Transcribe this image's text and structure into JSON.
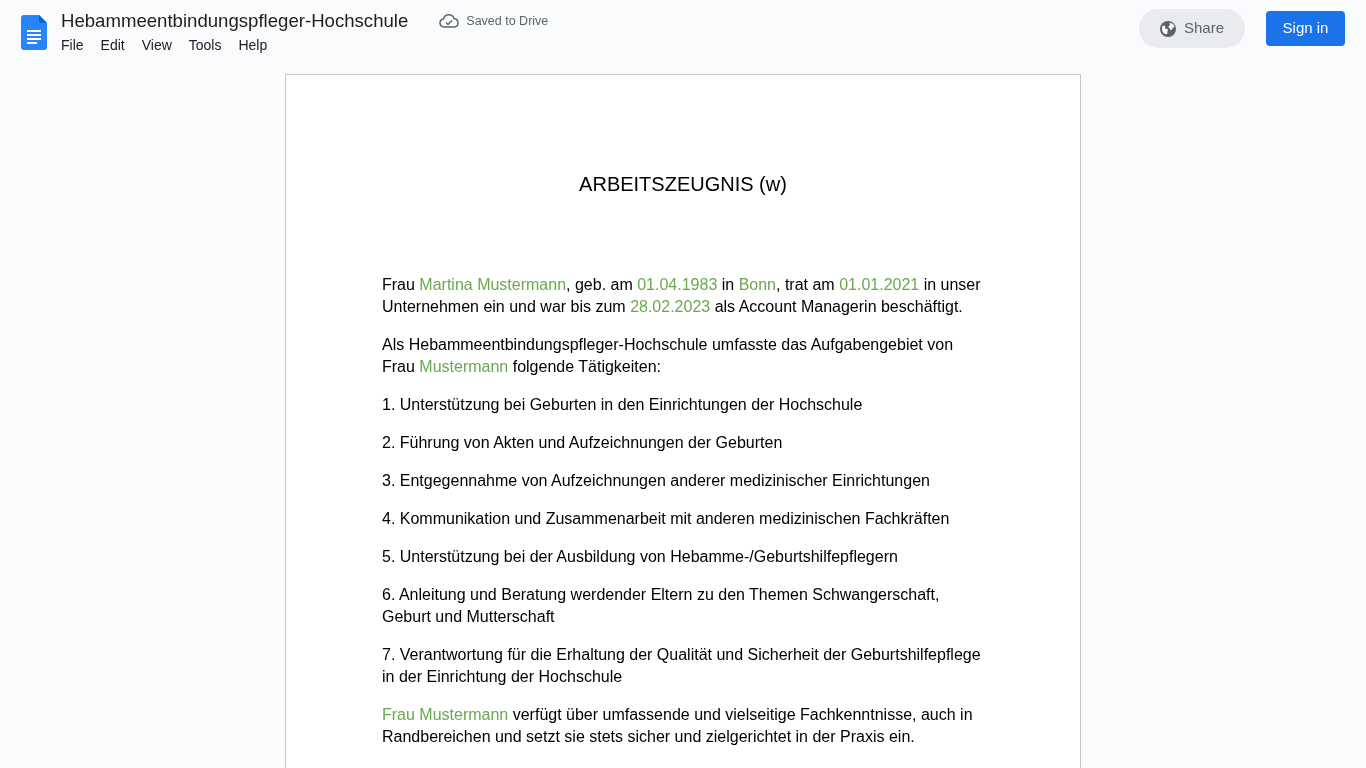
{
  "header": {
    "title": "Hebammeentbindungspfleger-Hochschule",
    "menu": [
      "File",
      "Edit",
      "View",
      "Tools",
      "Help"
    ],
    "save_status": "Saved to Drive",
    "share_button": "Share",
    "sign_in_button": "Sign in"
  },
  "document": {
    "title": "ARBEITSZEUGNIS (w)",
    "paragraphs": [
      {
        "segments": [
          {
            "text": "Frau ",
            "variable": false
          },
          {
            "text": "Martina Mustermann",
            "variable": true
          },
          {
            "text": ", geb. am ",
            "variable": false
          },
          {
            "text": "01.04.1983",
            "variable": true
          },
          {
            "text": " in ",
            "variable": false
          },
          {
            "text": "Bonn",
            "variable": true
          },
          {
            "text": ", trat am ",
            "variable": false
          },
          {
            "text": "01.01.2021",
            "variable": true
          },
          {
            "text": " in unser Unternehmen ein und war bis zum ",
            "variable": false
          },
          {
            "text": "28.02.2023",
            "variable": true
          },
          {
            "text": " als Account Managerin beschäftigt.",
            "variable": false
          }
        ]
      },
      {
        "segments": [
          {
            "text": "Als Hebammeentbindungspfleger-Hochschule umfasste das Aufgabengebiet von Frau ",
            "variable": false
          },
          {
            "text": "Mustermann",
            "variable": true
          },
          {
            "text": " folgende Tätigkeiten:",
            "variable": false
          }
        ]
      },
      {
        "segments": [
          {
            "text": "1. Unterstützung bei Geburten in den Einrichtungen der Hochschule",
            "variable": false
          }
        ]
      },
      {
        "segments": [
          {
            "text": "2. Führung von Akten und Aufzeichnungen der Geburten",
            "variable": false
          }
        ]
      },
      {
        "segments": [
          {
            "text": "3. Entgegennahme von Aufzeichnungen anderer medizinischer Einrichtungen",
            "variable": false
          }
        ]
      },
      {
        "segments": [
          {
            "text": "4. Kommunikation und Zusammenarbeit mit anderen medizinischen Fachkräften",
            "variable": false
          }
        ]
      },
      {
        "segments": [
          {
            "text": "5. Unterstützung bei der Ausbildung von Hebamme-/Geburtshilfepflegern",
            "variable": false
          }
        ]
      },
      {
        "segments": [
          {
            "text": "6. Anleitung und Beratung werdender Eltern zu den Themen Schwangerschaft, Geburt und Mutterschaft",
            "variable": false
          }
        ]
      },
      {
        "segments": [
          {
            "text": "7. Verantwortung für die Erhaltung der Qualität und Sicherheit der Geburtshilfepflege in der Einrichtung der Hochschule",
            "variable": false
          }
        ]
      },
      {
        "segments": [
          {
            "text": "Frau Mustermann",
            "variable": true
          },
          {
            "text": " verfügt über umfassende und vielseitige Fachkenntnisse, auch in Randbereichen und setzt sie stets sicher und zielgerichtet in der Praxis ein.",
            "variable": false
          }
        ]
      }
    ]
  }
}
